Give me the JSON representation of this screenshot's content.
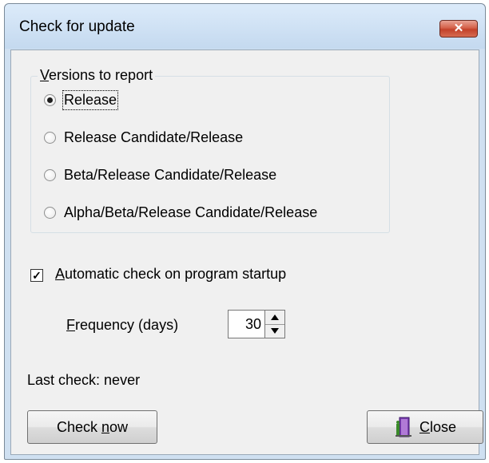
{
  "window": {
    "title": "Check for update",
    "close_glyph": "✕"
  },
  "group": {
    "title": "Versions to report",
    "options": [
      {
        "label": "Release",
        "selected": true
      },
      {
        "label": "Release Candidate/Release",
        "selected": false
      },
      {
        "label": "Beta/Release Candidate/Release",
        "selected": false
      },
      {
        "label": "Alpha/Beta/Release Candidate/Release",
        "selected": false
      }
    ]
  },
  "auto_check": {
    "label": "Automatic check on program startup",
    "checked": true
  },
  "frequency": {
    "label": "Frequency (days)",
    "value": "30"
  },
  "last_check": "Last check: never",
  "buttons": {
    "check_now": "Check now",
    "close": "Close"
  },
  "icons": {
    "close_window": "close-icon",
    "exit": "exit-door-icon",
    "spin_up": "arrow-up-icon",
    "spin_down": "arrow-down-icon"
  }
}
